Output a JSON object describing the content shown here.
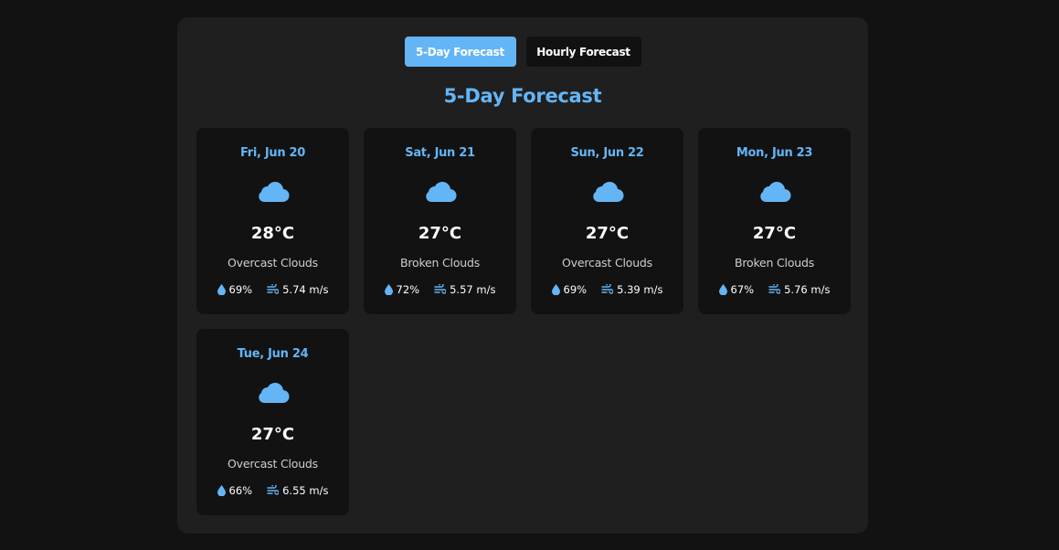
{
  "tabs": [
    {
      "label": "5-Day Forecast",
      "active": true
    },
    {
      "label": "Hourly Forecast",
      "active": false
    }
  ],
  "heading": "5-Day Forecast",
  "colors": {
    "accent": "#64b5f6",
    "page_bg": "#121212",
    "panel_bg": "#1f1f1f",
    "card_bg": "#121212"
  },
  "days": [
    {
      "date": "Fri, Jun 20",
      "icon": "cloud-icon",
      "temp": "28°C",
      "desc": "Overcast Clouds",
      "humidity": "69%",
      "wind": "5.74 m/s"
    },
    {
      "date": "Sat, Jun 21",
      "icon": "cloud-icon",
      "temp": "27°C",
      "desc": "Broken Clouds",
      "humidity": "72%",
      "wind": "5.57 m/s"
    },
    {
      "date": "Sun, Jun 22",
      "icon": "cloud-icon",
      "temp": "27°C",
      "desc": "Overcast Clouds",
      "humidity": "69%",
      "wind": "5.39 m/s"
    },
    {
      "date": "Mon, Jun 23",
      "icon": "cloud-icon",
      "temp": "27°C",
      "desc": "Broken Clouds",
      "humidity": "67%",
      "wind": "5.76 m/s"
    },
    {
      "date": "Tue, Jun 24",
      "icon": "cloud-icon",
      "temp": "27°C",
      "desc": "Overcast Clouds",
      "humidity": "66%",
      "wind": "6.55 m/s"
    }
  ]
}
